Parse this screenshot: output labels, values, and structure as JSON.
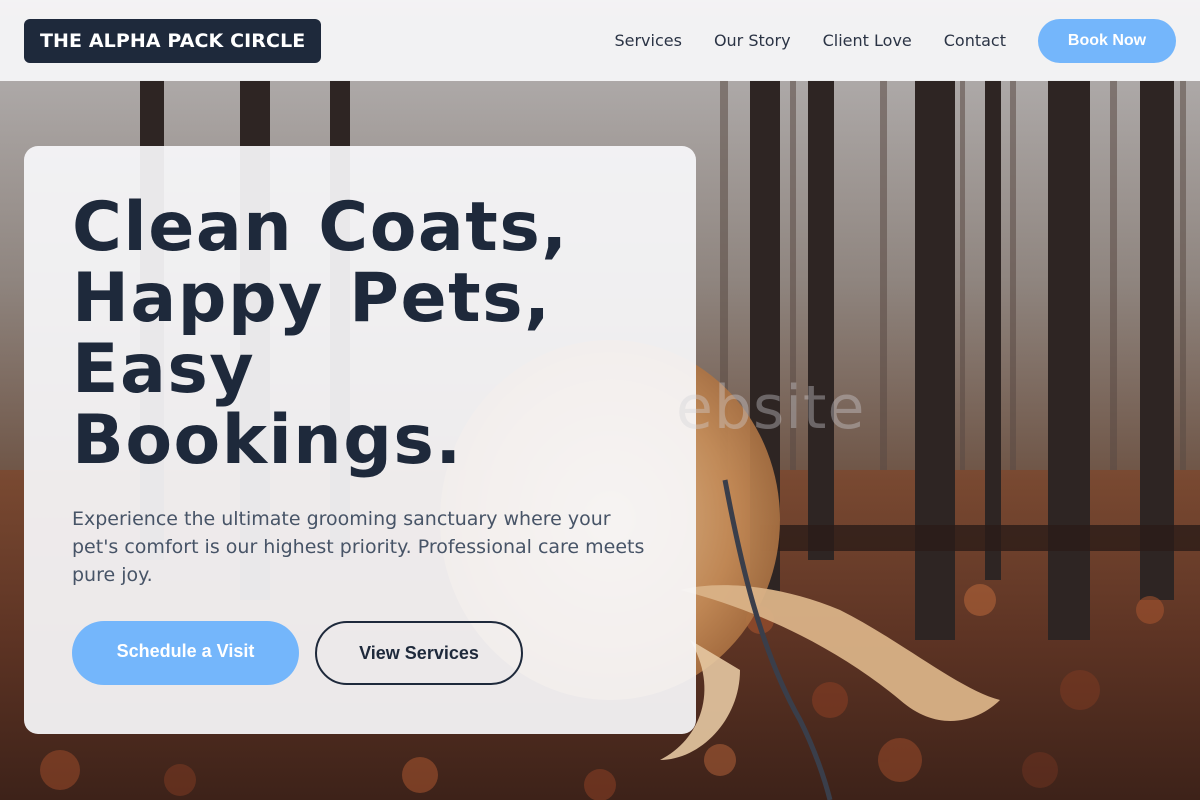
{
  "header": {
    "logo_text": "THE ALPHA PACK CIRCLE",
    "nav": [
      {
        "label": "Services"
      },
      {
        "label": "Our Story"
      },
      {
        "label": "Client Love"
      },
      {
        "label": "Contact"
      }
    ],
    "book_label": "Book Now"
  },
  "hero": {
    "title_lines": [
      "Clean Coats,",
      "Happy Pets,",
      "Easy",
      "Bookings."
    ],
    "subtitle": "Experience the ultimate grooming sanctuary where your pet's comfort is our highest priority. Professional care meets pure joy.",
    "primary_cta": "Schedule a Visit",
    "secondary_cta": "View Services",
    "watermark": "ebsite"
  },
  "colors": {
    "accent": "#74b6fb",
    "dark": "#1e293b",
    "text_muted": "#475467"
  },
  "background": {
    "subject": "dog on leash in autumn forest with fallen leaves"
  }
}
